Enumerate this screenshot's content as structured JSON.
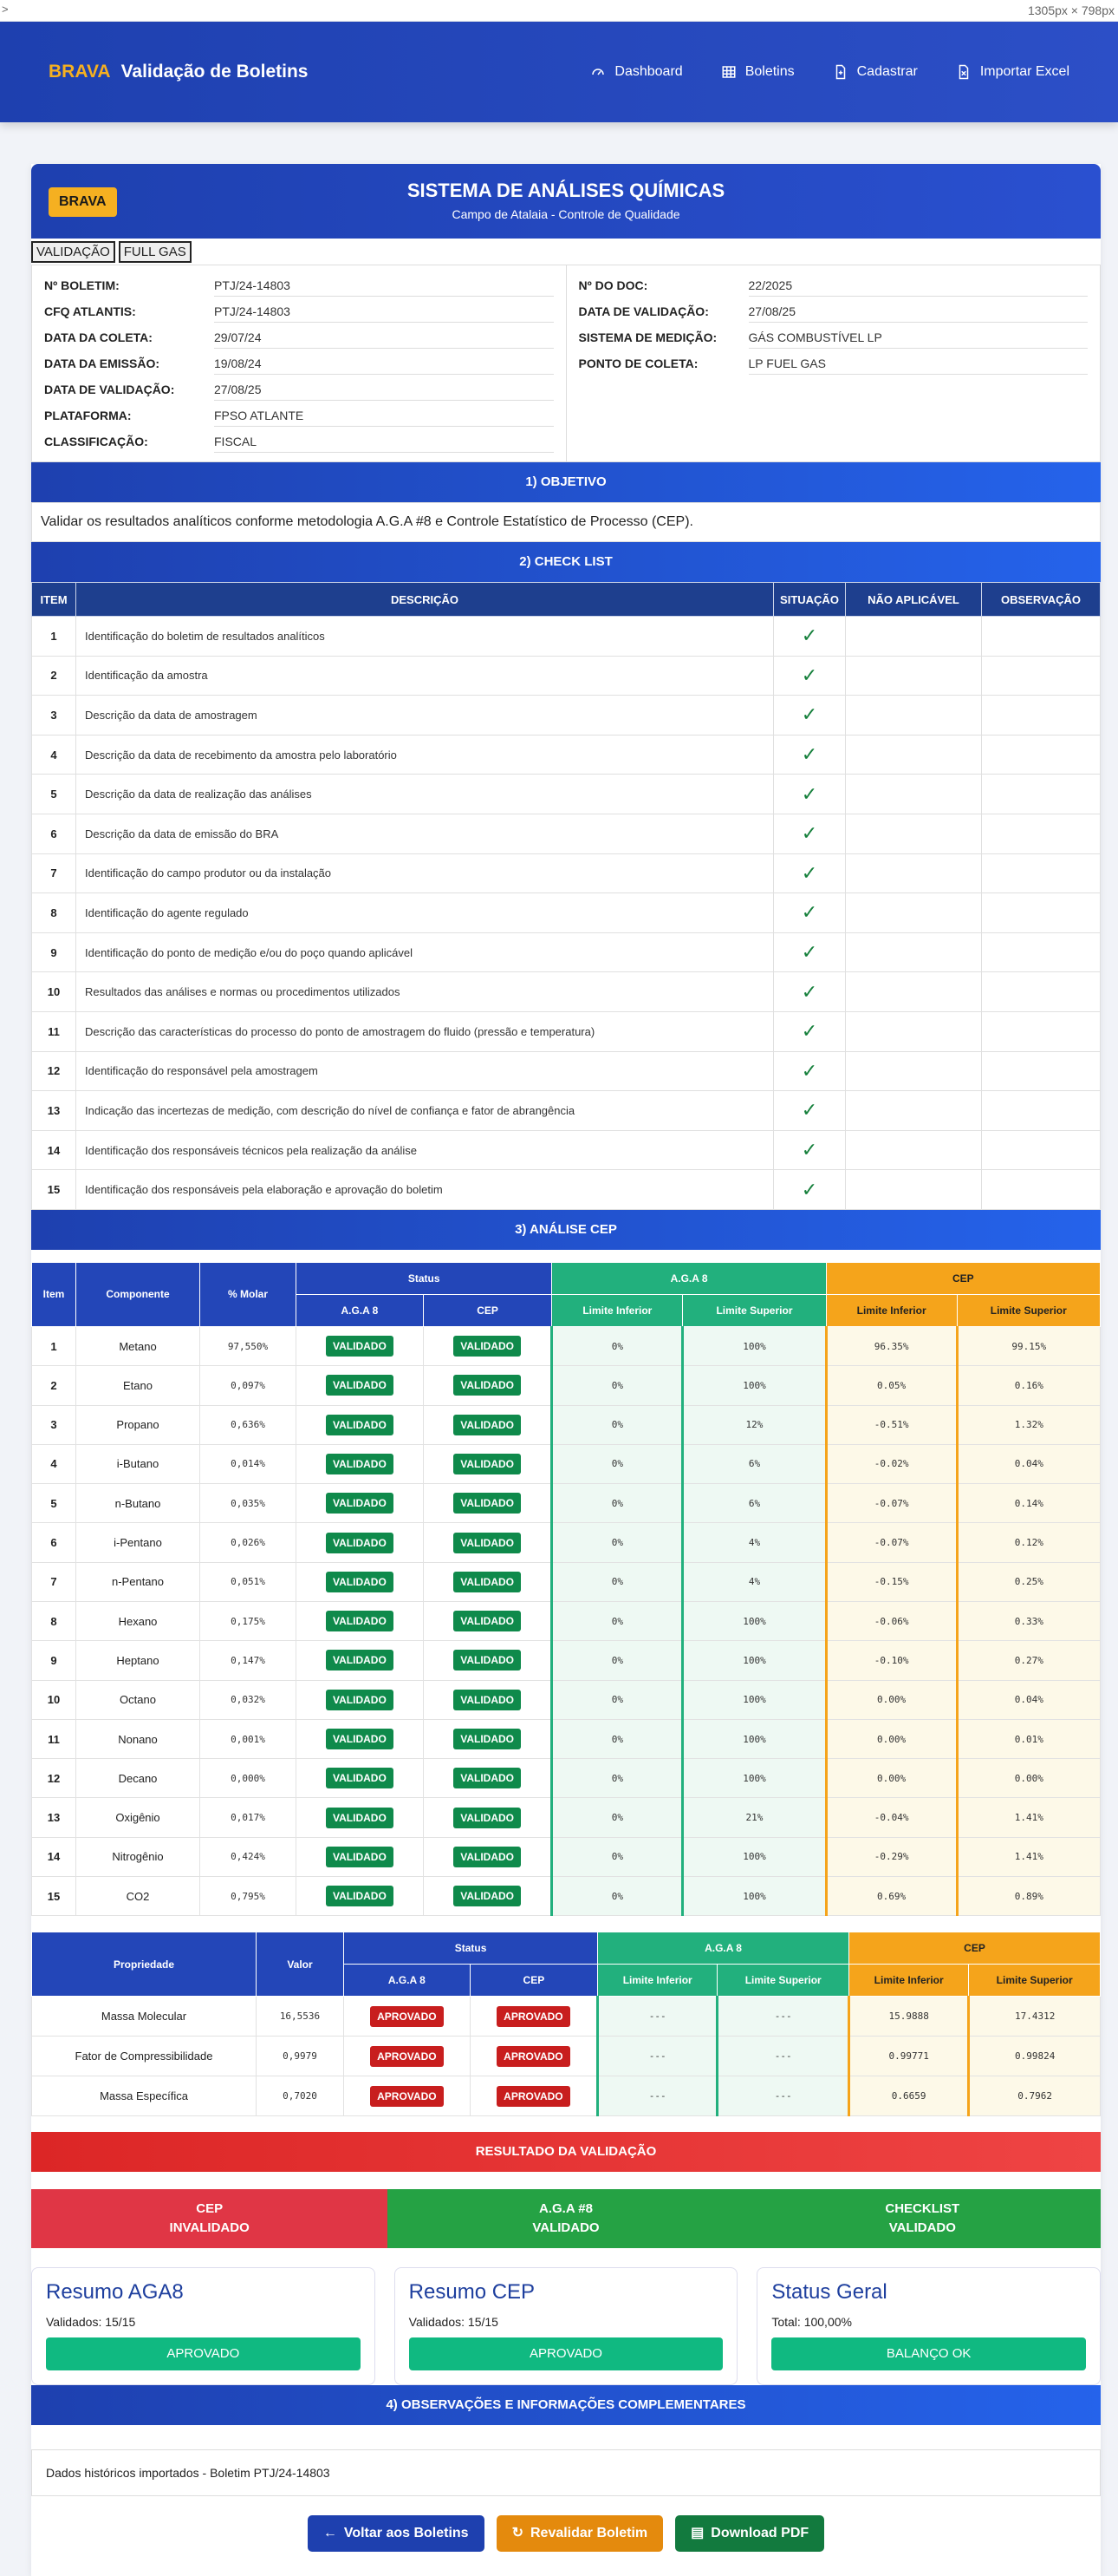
{
  "topstrip": {
    "left": ">",
    "right": "1305px × 798px"
  },
  "navbar": {
    "brand": "BRAVA",
    "title": "Validação de Boletins",
    "links": [
      "Dashboard",
      "Boletins",
      "Cadastrar",
      "Importar Excel"
    ]
  },
  "header": {
    "logo": "BRAVA",
    "title": "SISTEMA DE ANÁLISES QUÍMICAS",
    "subtitle": "Campo de Atalaia - Controle de Qualidade"
  },
  "tags": [
    "VALIDAÇÃO",
    "FULL GAS"
  ],
  "info_left": [
    {
      "k": "Nº BOLETIM:",
      "v": "PTJ/24-14803"
    },
    {
      "k": "CFQ ATLANTIS:",
      "v": "PTJ/24-14803"
    },
    {
      "k": "DATA DA COLETA:",
      "v": "29/07/24"
    },
    {
      "k": "DATA DA EMISSÃO:",
      "v": "19/08/24"
    },
    {
      "k": "DATA DE VALIDAÇÃO:",
      "v": "27/08/25"
    },
    {
      "k": "PLATAFORMA:",
      "v": "FPSO ATLANTE"
    },
    {
      "k": "CLASSIFICAÇÃO:",
      "v": "FISCAL"
    }
  ],
  "info_right": [
    {
      "k": "Nº DO DOC:",
      "v": "22/2025"
    },
    {
      "k": "DATA DE VALIDAÇÃO:",
      "v": "27/08/25"
    },
    {
      "k": "SISTEMA DE MEDIÇÃO:",
      "v": "GÁS COMBUSTÍVEL LP"
    },
    {
      "k": "PONTO DE COLETA:",
      "v": "LP FUEL GAS"
    }
  ],
  "objetivo": {
    "title": "1) OBJETIVO",
    "text": "Validar os resultados analíticos conforme metodologia A.G.A #8 e Controle Estatístico de Processo (CEP)."
  },
  "checklist": {
    "title": "2) CHECK LIST",
    "headers": [
      "ITEM",
      "DESCRIÇÃO",
      "SITUAÇÃO",
      "NÃO APLICÁVEL",
      "OBSERVAÇÃO"
    ],
    "check": "✓",
    "items": [
      "Identificação do boletim de resultados analíticos",
      "Identificação da amostra",
      "Descrição da data de amostragem",
      "Descrição da data de recebimento da amostra pelo laboratório",
      "Descrição da data de realização das análises",
      "Descrição da data de emissão do BRA",
      "Identificação do campo produtor ou da instalação",
      "Identificação do agente regulado",
      "Identificação do ponto de medição e/ou do poço quando aplicável",
      "Resultados das análises e normas ou procedimentos utilizados",
      "Descrição das características do processo do ponto de amostragem do fluido (pressão e temperatura)",
      "Identificação do responsável pela amostragem",
      "Indicação das incertezas de medição, com descrição do nível de confiança e fator de abrangência",
      "Identificação dos responsáveis técnicos pela realização da análise",
      "Identificação dos responsáveis pela elaboração e aprovação do boletim"
    ]
  },
  "cep": {
    "title": "3) ANÁLISE CEP",
    "h_item": "Item",
    "h_comp": "Componente",
    "h_molar": "% Molar",
    "h_status": "Status",
    "h_aga": "A.G.A 8",
    "h_cepgroup": "CEP",
    "h_sub": [
      "A.G.A 8",
      "CEP",
      "Limite Inferior",
      "Limite Superior",
      "Limite Inferior",
      "Limite Superior"
    ],
    "rows": [
      [
        "1",
        "Metano",
        "97,550%",
        "VALIDADO",
        "VALIDADO",
        "0%",
        "100%",
        "96.35%",
        "99.15%"
      ],
      [
        "2",
        "Etano",
        "0,097%",
        "VALIDADO",
        "VALIDADO",
        "0%",
        "100%",
        "0.05%",
        "0.16%"
      ],
      [
        "3",
        "Propano",
        "0,636%",
        "VALIDADO",
        "VALIDADO",
        "0%",
        "12%",
        "-0.51%",
        "1.32%"
      ],
      [
        "4",
        "i-Butano",
        "0,014%",
        "VALIDADO",
        "VALIDADO",
        "0%",
        "6%",
        "-0.02%",
        "0.04%"
      ],
      [
        "5",
        "n-Butano",
        "0,035%",
        "VALIDADO",
        "VALIDADO",
        "0%",
        "6%",
        "-0.07%",
        "0.14%"
      ],
      [
        "6",
        "i-Pentano",
        "0,026%",
        "VALIDADO",
        "VALIDADO",
        "0%",
        "4%",
        "-0.07%",
        "0.12%"
      ],
      [
        "7",
        "n-Pentano",
        "0,051%",
        "VALIDADO",
        "VALIDADO",
        "0%",
        "4%",
        "-0.15%",
        "0.25%"
      ],
      [
        "8",
        "Hexano",
        "0,175%",
        "VALIDADO",
        "VALIDADO",
        "0%",
        "100%",
        "-0.06%",
        "0.33%"
      ],
      [
        "9",
        "Heptano",
        "0,147%",
        "VALIDADO",
        "VALIDADO",
        "0%",
        "100%",
        "-0.10%",
        "0.27%"
      ],
      [
        "10",
        "Octano",
        "0,032%",
        "VALIDADO",
        "VALIDADO",
        "0%",
        "100%",
        "0.00%",
        "0.04%"
      ],
      [
        "11",
        "Nonano",
        "0,001%",
        "VALIDADO",
        "VALIDADO",
        "0%",
        "100%",
        "0.00%",
        "0.01%"
      ],
      [
        "12",
        "Decano",
        "0,000%",
        "VALIDADO",
        "VALIDADO",
        "0%",
        "100%",
        "0.00%",
        "0.00%"
      ],
      [
        "13",
        "Oxigênio",
        "0,017%",
        "VALIDADO",
        "VALIDADO",
        "0%",
        "21%",
        "-0.04%",
        "1.41%"
      ],
      [
        "14",
        "Nitrogênio",
        "0,424%",
        "VALIDADO",
        "VALIDADO",
        "0%",
        "100%",
        "-0.29%",
        "1.41%"
      ],
      [
        "15",
        "CO2",
        "0,795%",
        "VALIDADO",
        "VALIDADO",
        "0%",
        "100%",
        "0.69%",
        "0.89%"
      ]
    ]
  },
  "props": {
    "h_prop": "Propriedade",
    "h_valor": "Valor",
    "rows": [
      [
        "Massa Molecular",
        "16,5536",
        "APROVADO",
        "APROVADO",
        "---",
        "---",
        "15.9888",
        "17.4312"
      ],
      [
        "Fator de Compressibilidade",
        "0,9979",
        "APROVADO",
        "APROVADO",
        "---",
        "---",
        "0.99771",
        "0.99824"
      ],
      [
        "Massa Específica",
        "0,7020",
        "APROVADO",
        "APROVADO",
        "---",
        "---",
        "0.6659",
        "0.7962"
      ]
    ]
  },
  "resultado": {
    "title": "RESULTADO DA VALIDAÇÃO",
    "items": [
      {
        "l1": "CEP",
        "l2": "INVALIDADO"
      },
      {
        "l1": "A.G.A #8",
        "l2": "VALIDADO"
      },
      {
        "l1": "CHECKLIST",
        "l2": "VALIDADO"
      }
    ]
  },
  "cards": [
    {
      "title": "Resumo AGA8",
      "line": "Validados: 15/15",
      "btn": "APROVADO"
    },
    {
      "title": "Resumo CEP",
      "line": "Validados: 15/15",
      "btn": "APROVADO"
    },
    {
      "title": "Status Geral",
      "line": "Total: 100,00%",
      "btn": "BALANÇO OK"
    }
  ],
  "obs": {
    "title": "4) OBSERVAÇÕES E INFORMAÇÕES COMPLEMENTARES",
    "text": "Dados históricos importados - Boletim PTJ/24-14803"
  },
  "actions": [
    "Voltar aos Boletins",
    "Revalidar Boletim",
    "Download PDF"
  ],
  "colors": {
    "primary": "#1e40af",
    "accent": "#f5b021",
    "success": "#10b981",
    "danger": "#dc2626"
  }
}
